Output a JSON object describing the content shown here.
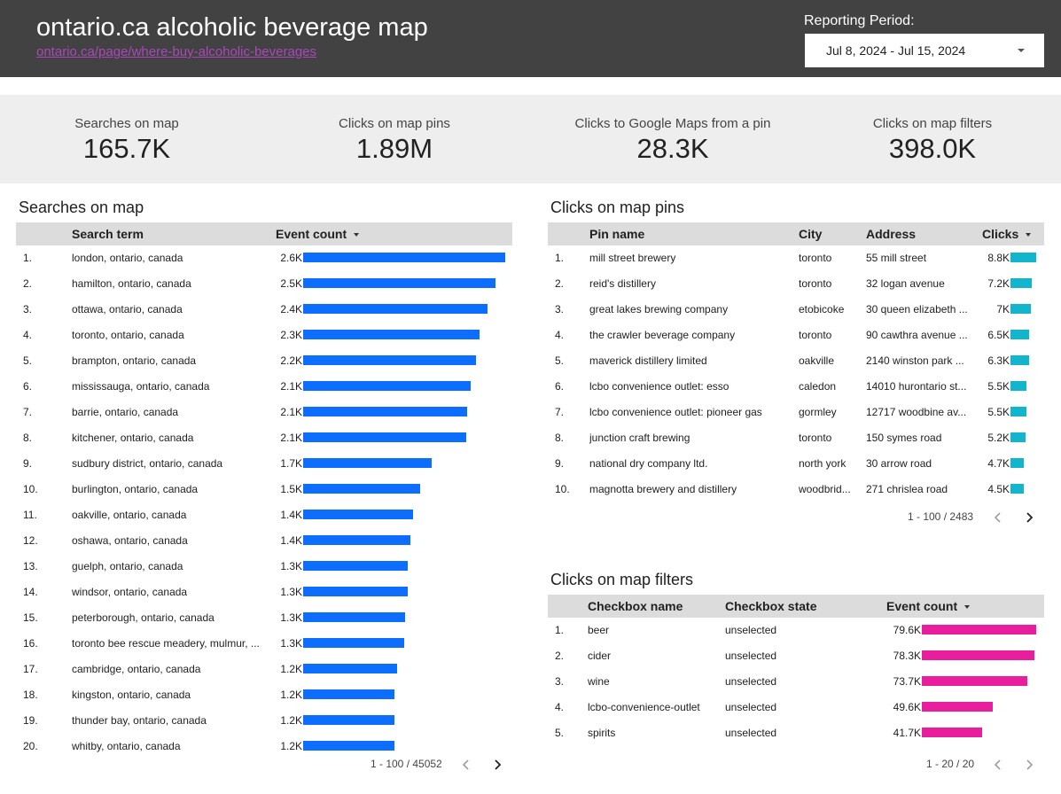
{
  "header": {
    "title": "ontario.ca alcoholic beverage map",
    "link": "ontario.ca/page/where-buy-alcoholic-beverages",
    "period_label": "Reporting Period:",
    "period_value": "Jul 8, 2024 - Jul 15, 2024"
  },
  "kpis": [
    {
      "label": "Searches on map",
      "value": "165.7K"
    },
    {
      "label": "Clicks on map pins",
      "value": "1.89M"
    },
    {
      "label": "Clicks to Google Maps from a pin",
      "value": "28.3K"
    },
    {
      "label": "Clicks on map filters",
      "value": "398.0K"
    }
  ],
  "searches": {
    "title": "Searches on map",
    "col_term": "Search term",
    "col_count": "Event count",
    "bar_color": "#0d6efd",
    "max": 2.6,
    "rows": [
      {
        "n": "1.",
        "term": "london, ontario, canada",
        "label": "2.6K",
        "value": 2.6
      },
      {
        "n": "2.",
        "term": "hamilton, ontario, canada",
        "label": "2.5K",
        "value": 2.48
      },
      {
        "n": "3.",
        "term": "ottawa, ontario, canada",
        "label": "2.4K",
        "value": 2.37
      },
      {
        "n": "4.",
        "term": "toronto, ontario, canada",
        "label": "2.3K",
        "value": 2.27
      },
      {
        "n": "5.",
        "term": "brampton, ontario, canada",
        "label": "2.2K",
        "value": 2.22
      },
      {
        "n": "6.",
        "term": "mississauga, ontario, canada",
        "label": "2.1K",
        "value": 2.15
      },
      {
        "n": "7.",
        "term": "barrie, ontario, canada",
        "label": "2.1K",
        "value": 2.11
      },
      {
        "n": "8.",
        "term": "kitchener, ontario, canada",
        "label": "2.1K",
        "value": 2.1
      },
      {
        "n": "9.",
        "term": "sudbury district, ontario, canada",
        "label": "1.7K",
        "value": 1.65
      },
      {
        "n": "10.",
        "term": "burlington, ontario, canada",
        "label": "1.5K",
        "value": 1.51
      },
      {
        "n": "11.",
        "term": "oakville, ontario, canada",
        "label": "1.4K",
        "value": 1.41
      },
      {
        "n": "12.",
        "term": "oshawa, ontario, canada",
        "label": "1.4K",
        "value": 1.38
      },
      {
        "n": "13.",
        "term": "guelph, ontario, canada",
        "label": "1.3K",
        "value": 1.35
      },
      {
        "n": "14.",
        "term": "windsor, ontario, canada",
        "label": "1.3K",
        "value": 1.34
      },
      {
        "n": "15.",
        "term": "peterborough, ontario, canada",
        "label": "1.3K",
        "value": 1.31
      },
      {
        "n": "16.",
        "term": "toronto bee rescue meadery, mulmur, ...",
        "label": "1.3K",
        "value": 1.3
      },
      {
        "n": "17.",
        "term": "cambridge, ontario, canada",
        "label": "1.2K",
        "value": 1.21
      },
      {
        "n": "18.",
        "term": "kingston, ontario, canada",
        "label": "1.2K",
        "value": 1.18
      },
      {
        "n": "19.",
        "term": "thunder bay, ontario, canada",
        "label": "1.2K",
        "value": 1.18
      },
      {
        "n": "20.",
        "term": "whitby, ontario, canada",
        "label": "1.2K",
        "value": 1.18
      }
    ],
    "pager": "1 - 100 / 45052"
  },
  "pins": {
    "title": "Clicks on map pins",
    "col_name": "Pin name",
    "col_city": "City",
    "col_address": "Address",
    "col_clicks": "Clicks",
    "bar_color": "#12b5cb",
    "max": 8.8,
    "rows": [
      {
        "n": "1.",
        "name": "mill street brewery",
        "city": "toronto",
        "address": "55 mill street",
        "label": "8.8K",
        "value": 8.8
      },
      {
        "n": "2.",
        "name": "reid's distillery",
        "city": "toronto",
        "address": "32 logan avenue",
        "label": "7.2K",
        "value": 7.2
      },
      {
        "n": "3.",
        "name": "great lakes brewing company",
        "city": "etobicoke",
        "address": "30 queen elizabeth ...",
        "label": "7K",
        "value": 7.0
      },
      {
        "n": "4.",
        "name": "the crawler beverage company",
        "city": "toronto",
        "address": "90 cawthra avenue ...",
        "label": "6.5K",
        "value": 6.5
      },
      {
        "n": "5.",
        "name": "maverick distillery limited",
        "city": "oakville",
        "address": "2140 winston park ...",
        "label": "6.3K",
        "value": 6.3
      },
      {
        "n": "6.",
        "name": "lcbo convenience outlet: esso",
        "city": "caledon",
        "address": "14010 hurontario st...",
        "label": "5.5K",
        "value": 5.5
      },
      {
        "n": "7.",
        "name": "lcbo convenience outlet: pioneer gas",
        "city": "gormley",
        "address": "12717 woodbine av...",
        "label": "5.5K",
        "value": 5.5
      },
      {
        "n": "8.",
        "name": "junction craft brewing",
        "city": "toronto",
        "address": "150 symes road",
        "label": "5.2K",
        "value": 5.2
      },
      {
        "n": "9.",
        "name": "national dry company ltd.",
        "city": "north york",
        "address": "30 arrow road",
        "label": "4.7K",
        "value": 4.7
      },
      {
        "n": "10.",
        "name": "magnotta brewery and distillery",
        "city": "woodbrid...",
        "address": "271 chrislea road",
        "label": "4.5K",
        "value": 4.5
      }
    ],
    "pager": "1 - 100 / 2483"
  },
  "filters": {
    "title": "Clicks on map filters",
    "col_name": "Checkbox name",
    "col_state": "Checkbox state",
    "col_count": "Event count",
    "bar_color": "#e91e9c",
    "max": 79.6,
    "rows": [
      {
        "n": "1.",
        "name": "beer",
        "state": "unselected",
        "label": "79.6K",
        "value": 79.6
      },
      {
        "n": "2.",
        "name": "cider",
        "state": "unselected",
        "label": "78.3K",
        "value": 78.3
      },
      {
        "n": "3.",
        "name": "wine",
        "state": "unselected",
        "label": "73.7K",
        "value": 73.7
      },
      {
        "n": "4.",
        "name": "lcbo-convenience-outlet",
        "state": "unselected",
        "label": "49.6K",
        "value": 49.6
      },
      {
        "n": "5.",
        "name": "spirits",
        "state": "unselected",
        "label": "41.7K",
        "value": 41.7
      }
    ],
    "pager": "1 - 20 / 20"
  },
  "icons": {
    "prev": "chevron-left-icon",
    "next": "chevron-right-icon",
    "caret": "caret-down-icon"
  }
}
